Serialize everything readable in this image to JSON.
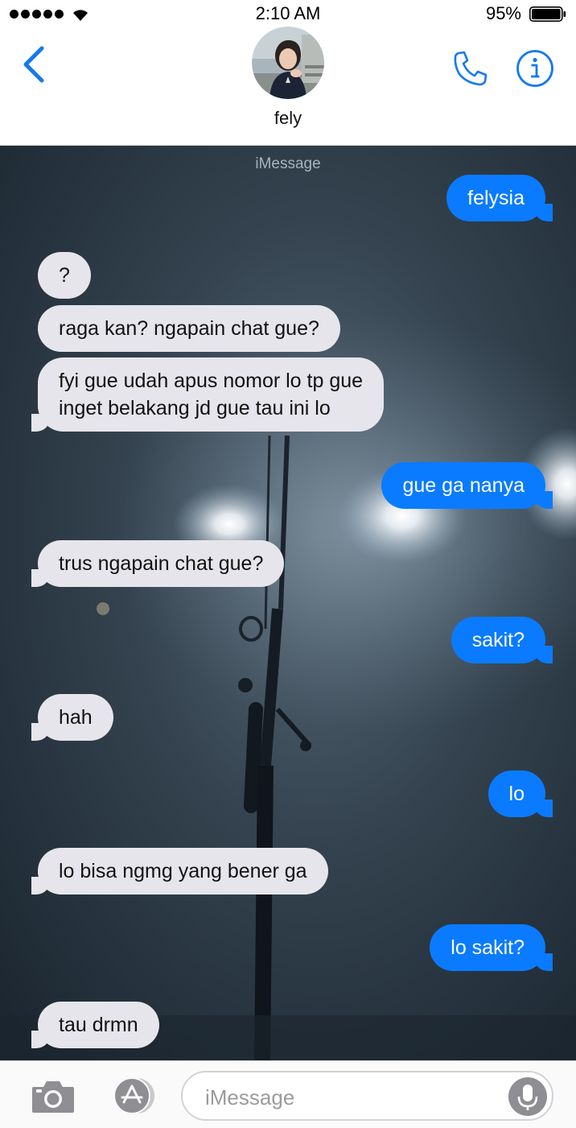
{
  "status_bar": {
    "time": "2:10 AM",
    "battery_percent": "95%",
    "signal_bars": 5,
    "battery_level": 0.95
  },
  "header": {
    "contact_name": "fely",
    "icons": [
      "chevron-left-icon",
      "contact-avatar",
      "phone-icon",
      "info-icon"
    ]
  },
  "chat": {
    "service_label": "iMessage",
    "messages": [
      {
        "direction": "outgoing",
        "text": "felysia"
      },
      {
        "direction": "incoming",
        "text": "?"
      },
      {
        "direction": "incoming",
        "text": "raga kan? ngapain chat gue?"
      },
      {
        "direction": "incoming",
        "line1": "fyi gue udah apus nomor lo tp gue",
        "line2": "inget belakang jd gue tau ini lo"
      },
      {
        "direction": "outgoing",
        "text": "gue ga nanya"
      },
      {
        "direction": "incoming",
        "text": "trus ngapain chat gue?"
      },
      {
        "direction": "outgoing",
        "text": "sakit?"
      },
      {
        "direction": "incoming",
        "text": "hah"
      },
      {
        "direction": "outgoing",
        "text": "lo"
      },
      {
        "direction": "incoming",
        "text": "lo bisa ngmg yang bener ga"
      },
      {
        "direction": "outgoing",
        "text": "lo sakit?"
      },
      {
        "direction": "incoming",
        "text": "tau drmn"
      }
    ]
  },
  "input_bar": {
    "placeholder": "iMessage",
    "icons": [
      "camera-icon",
      "app-store-icon",
      "microphone-icon"
    ]
  },
  "colors": {
    "accent": "#0A7BFF",
    "incoming_bubble": "#E6E5EB",
    "outgoing_bubble": "#0A7BFF",
    "chat_background": "#2A3742"
  }
}
